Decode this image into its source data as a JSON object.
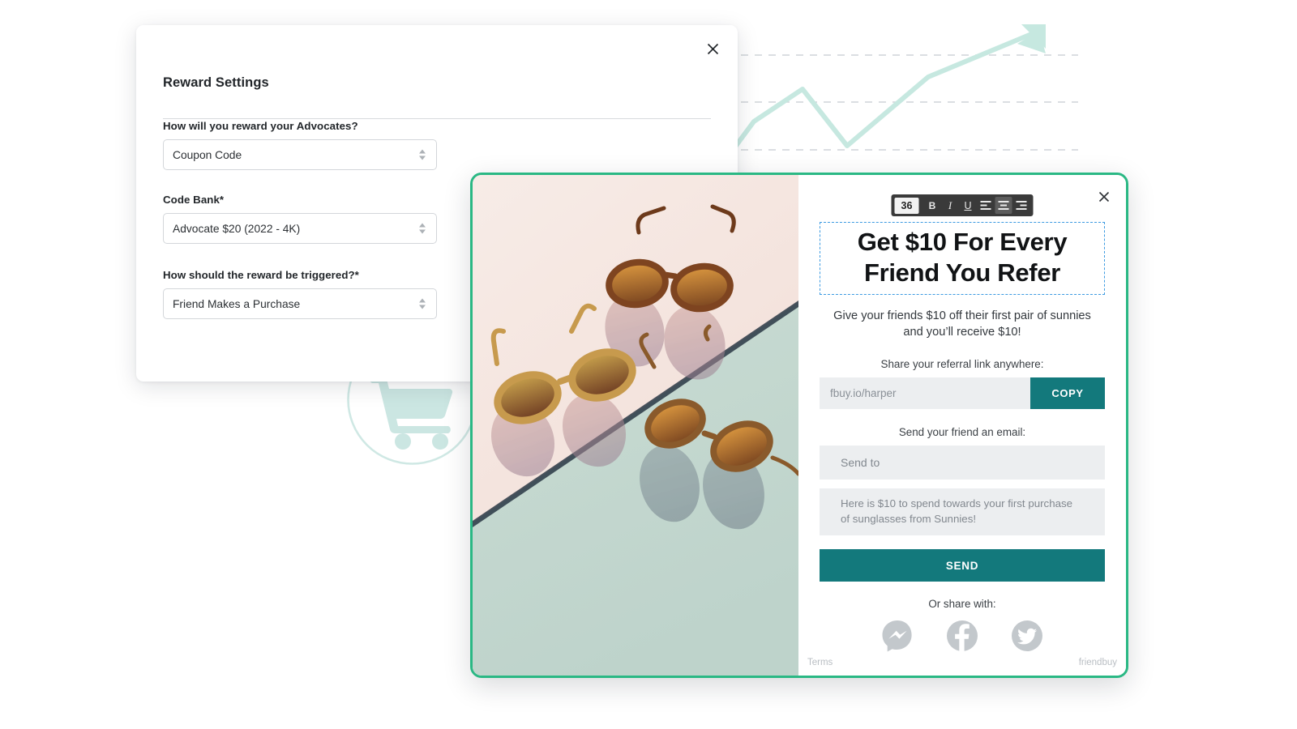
{
  "settings_panel": {
    "title": "Reward Settings",
    "close_icon": "close-icon",
    "fields": [
      {
        "label": "How will you reward your Advocates?",
        "value": "Coupon Code"
      },
      {
        "label": "Code Bank*",
        "value": "Advocate $20 (2022 - 4K)"
      },
      {
        "label": "How should the reward be triggered?*",
        "value": "Friend Makes a Purchase"
      }
    ]
  },
  "widget": {
    "close_icon": "close-icon",
    "toolbar": {
      "font_size": "36",
      "bold_label": "B",
      "italic_label": "I",
      "underline_label": "U",
      "align_left": "align-left-icon",
      "align_center": "align-center-icon",
      "align_right": "align-right-icon",
      "active_alignment": "center"
    },
    "headline": "Get $10 For Every Friend You Refer",
    "subtext": "Give your friends $10 off their first pair of sunnies and you’ll receive $10!",
    "share_link_label": "Share your referral link anywhere:",
    "referral_link_placeholder": "fbuy.io/harper",
    "copy_label": "COPY",
    "email_label": "Send your friend an email:",
    "send_to_placeholder": "Send to",
    "message_placeholder": "Here is $10 to spend towards your first purchase of sunglasses from Sunnies!",
    "send_label": "SEND",
    "share_with_label": "Or share with:",
    "social": [
      {
        "name": "messenger-icon",
        "label": "Messenger"
      },
      {
        "name": "facebook-icon",
        "label": "Facebook"
      },
      {
        "name": "twitter-icon",
        "label": "Twitter"
      }
    ],
    "terms_label": "Terms",
    "brand_label": "friendbuy"
  },
  "decorations": {
    "cart_icon": "shopping-cart-icon",
    "chart_icon": "growth-arrow-chart"
  },
  "colors": {
    "teal_button": "#13797c",
    "widget_border": "#2ab884",
    "decor_mint": "#c6e8e0",
    "selection_blue": "#3b9ae1",
    "toolbar_dark": "#3a3a3a"
  }
}
